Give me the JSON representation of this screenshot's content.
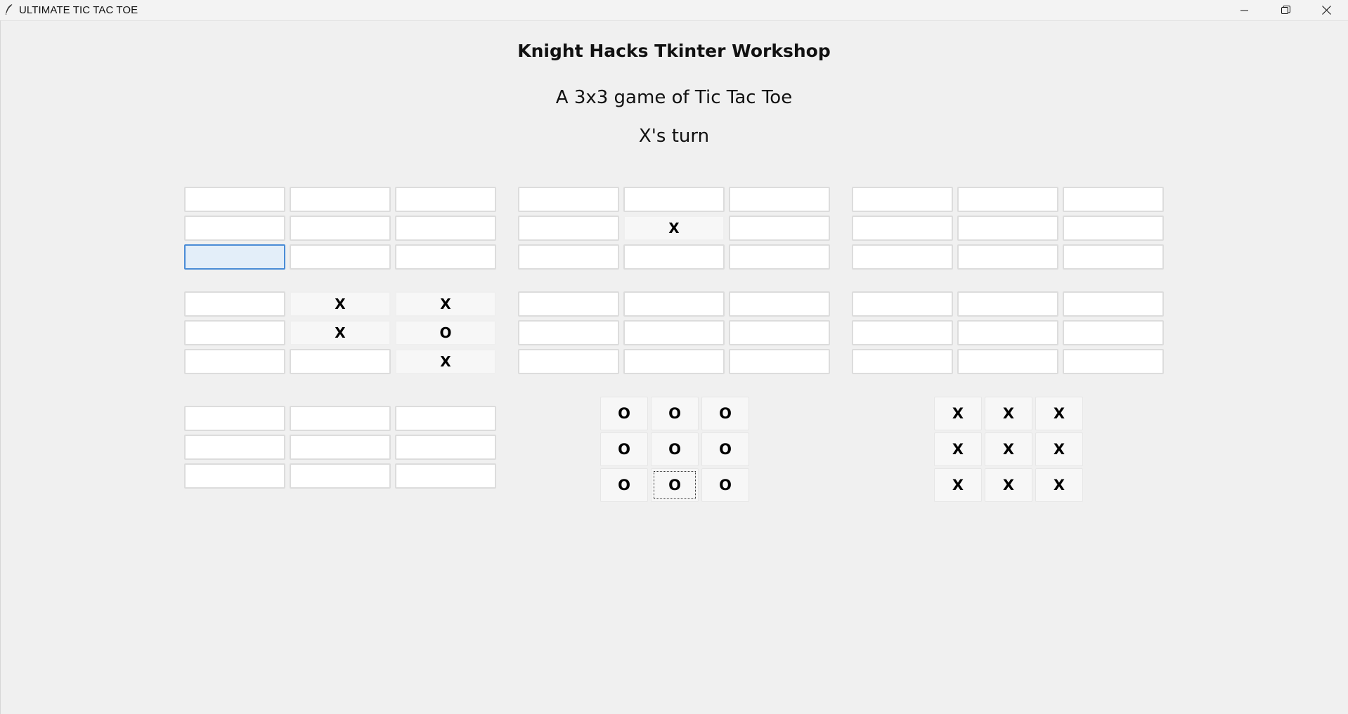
{
  "window": {
    "title": "ULTIMATE TIC TAC TOE",
    "icon": "feather-icon",
    "controls": [
      "minimize-icon",
      "restore-icon",
      "close-icon"
    ]
  },
  "header": {
    "title": "Knight Hacks Tkinter Workshop",
    "subtitle": "A 3x3 game of Tic Tac Toe",
    "status": "X's turn"
  },
  "colors": {
    "background": "#f0f0f0",
    "cell_empty": "#ffffff",
    "cell_filled": "#f7f7f7",
    "focus_fill": "#e3eef9",
    "focus_border": "#4a8cd6"
  },
  "boards": [
    {
      "id": "top-left",
      "won": false,
      "cells": [
        "",
        "",
        "",
        "",
        "",
        "",
        "",
        "",
        ""
      ]
    },
    {
      "id": "top-middle",
      "won": false,
      "cells": [
        "",
        "",
        "",
        "",
        "X",
        "",
        "",
        "",
        ""
      ]
    },
    {
      "id": "top-right",
      "won": false,
      "cells": [
        "",
        "",
        "",
        "",
        "",
        "",
        "",
        "",
        ""
      ]
    },
    {
      "id": "middle-left",
      "won": false,
      "cells": [
        "",
        "X",
        "X",
        "",
        "X",
        "O",
        "",
        "",
        "X"
      ]
    },
    {
      "id": "center",
      "won": false,
      "cells": [
        "",
        "",
        "",
        "",
        "",
        "",
        "",
        "",
        ""
      ]
    },
    {
      "id": "middle-right",
      "won": false,
      "cells": [
        "",
        "",
        "",
        "",
        "",
        "",
        "",
        "",
        ""
      ]
    },
    {
      "id": "bottom-left",
      "won": false,
      "cells": [
        "",
        "",
        "",
        "",
        "",
        "",
        "",
        "",
        ""
      ]
    },
    {
      "id": "bottom-middle",
      "won": true,
      "winner": "O",
      "cells": [
        "O",
        "O",
        "O",
        "O",
        "O",
        "O",
        "O",
        "O",
        "O"
      ]
    },
    {
      "id": "bottom-right",
      "won": true,
      "winner": "X",
      "cells": [
        "X",
        "X",
        "X",
        "X",
        "X",
        "X",
        "X",
        "X",
        "X"
      ]
    }
  ]
}
